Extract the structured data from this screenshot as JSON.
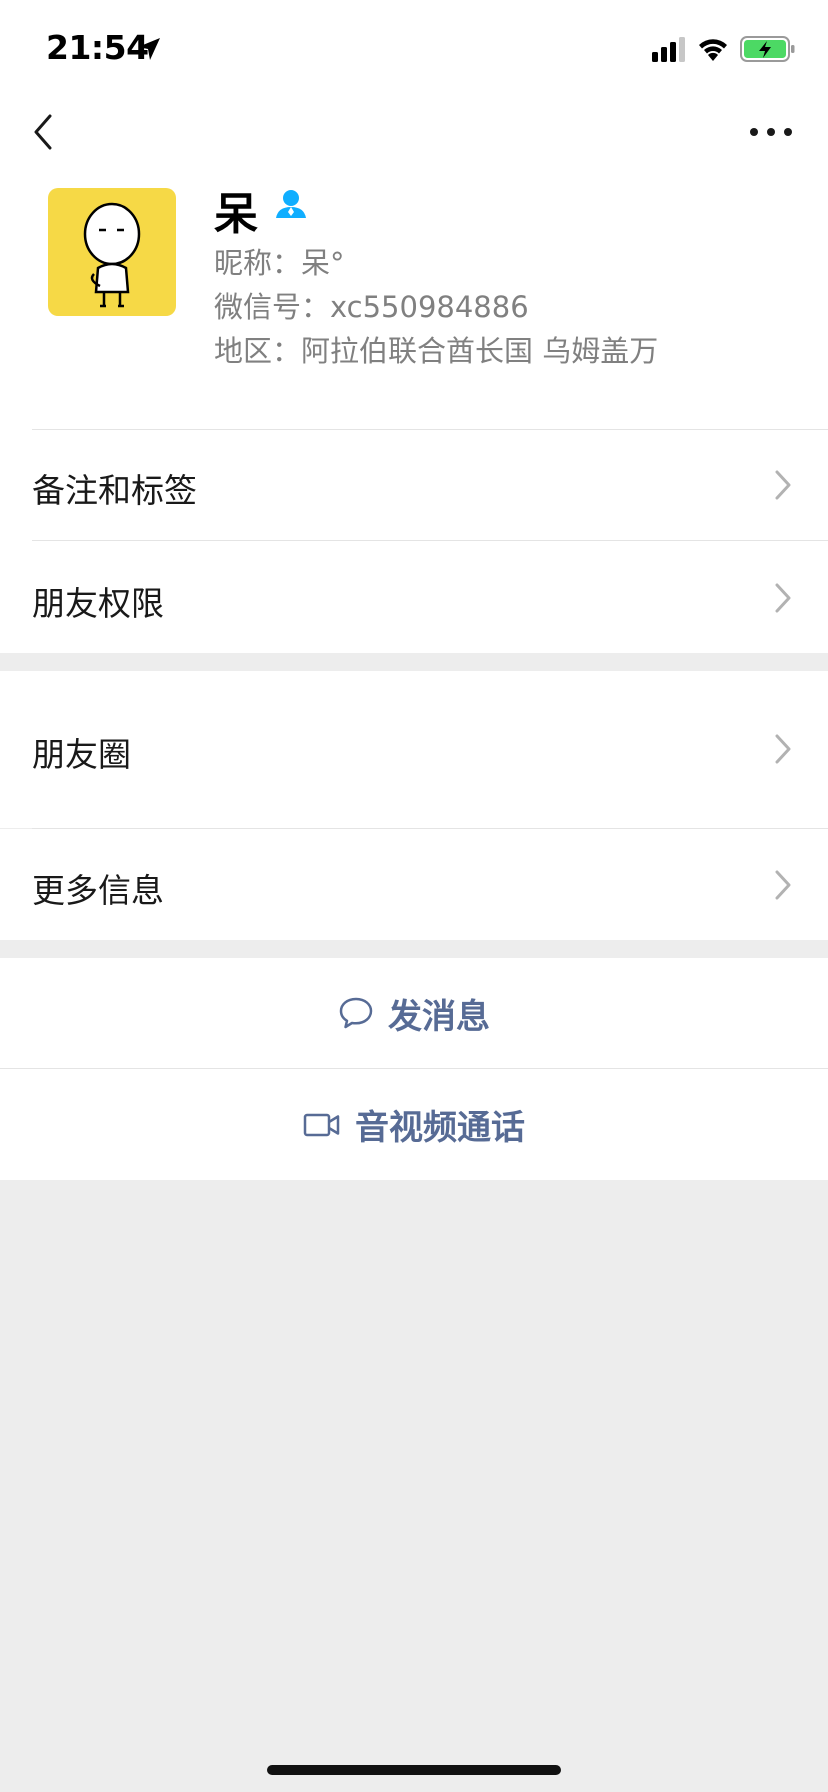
{
  "status_bar": {
    "time": "21:54",
    "battery_color": "#4cd964"
  },
  "nav": {
    "back_icon": "chevron-left-icon",
    "more_icon": "ellipsis-icon"
  },
  "profile": {
    "name": "呆",
    "nickname": "昵称：呆°",
    "wechat_id": "微信号：xc550984886",
    "region": "地区：阿拉伯联合酋长国 乌姆盖万",
    "avatar_bg": "#f6d946",
    "verify_color": "#10aeff"
  },
  "menu": {
    "remarks_tags": "备注和标签",
    "friend_permissions": "朋友权限",
    "moments": "朋友圈",
    "more_info": "更多信息"
  },
  "actions": {
    "send_message": "发消息",
    "video_call": "音视频通话",
    "link_color": "#576b95"
  }
}
